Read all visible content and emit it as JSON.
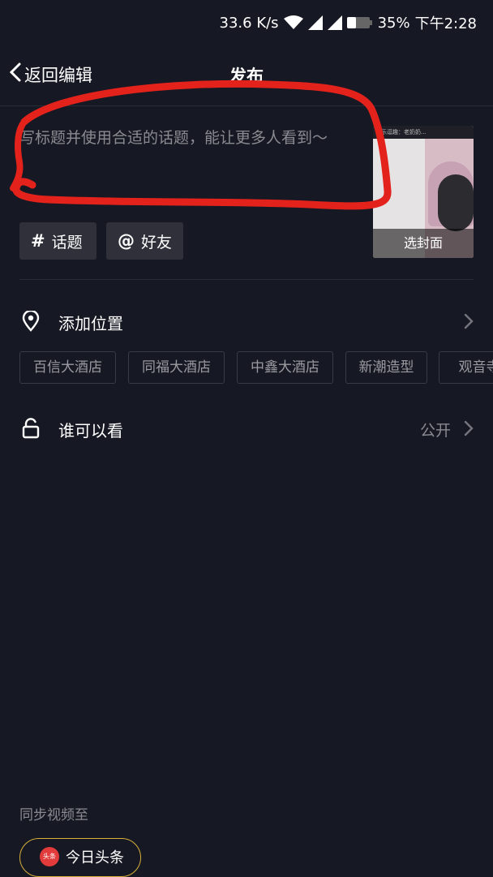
{
  "status_bar": {
    "speed": "33.6 K/s",
    "battery": "35%",
    "time": "下午2:28"
  },
  "header": {
    "back_label": "返回编辑",
    "title": "发布"
  },
  "caption": {
    "placeholder": "写标题并使用合适的话题，能让更多人看到～"
  },
  "cover": {
    "header_text": "游乐逗趣：老奶奶...",
    "label": "选封面"
  },
  "tags": [
    {
      "symbol": "#",
      "label": "话题"
    },
    {
      "symbol": "@",
      "label": "好友"
    }
  ],
  "location": {
    "label": "添加位置",
    "suggestions": [
      "百信大酒店",
      "同福大酒店",
      "中鑫大酒店",
      "新潮造型",
      "观音寺"
    ]
  },
  "privacy": {
    "label": "谁可以看",
    "value": "公开"
  },
  "sync": {
    "label": "同步视频至",
    "target": "今日头条",
    "target_icon_text": "头条"
  },
  "annotation": {
    "color": "#e3221c"
  },
  "icons": [
    "wifi-icon",
    "signal-icon",
    "battery-icon",
    "back-chevron-icon",
    "location-pin-icon",
    "chevron-right-icon",
    "unlock-icon"
  ]
}
